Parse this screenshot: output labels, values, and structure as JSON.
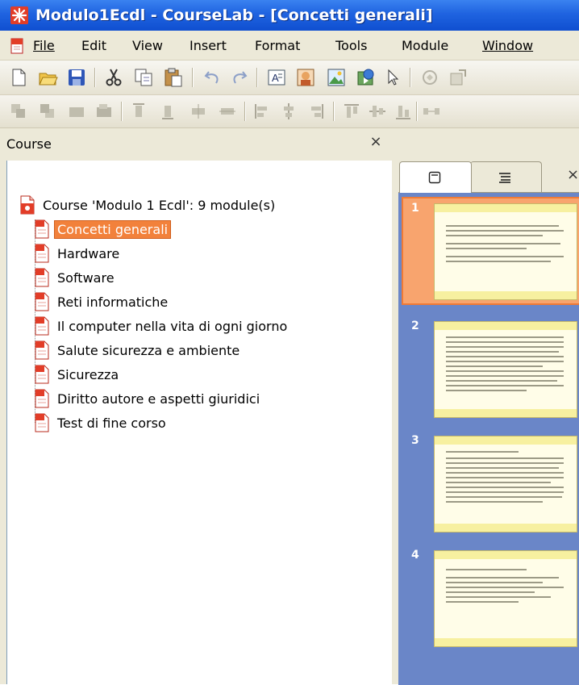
{
  "window": {
    "title": "Modulo1Ecdl - CourseLab - [Concetti generali]"
  },
  "menubar": {
    "items": [
      {
        "label": "File"
      },
      {
        "label": "Edit"
      },
      {
        "label": "View"
      },
      {
        "label": "Insert"
      },
      {
        "label": "Format"
      },
      {
        "label": "Tools"
      },
      {
        "label": "Module"
      },
      {
        "label": "Window"
      }
    ]
  },
  "toolbar1": {
    "icons": [
      "new-icon",
      "open-icon",
      "save-icon",
      "cut-icon",
      "copy-icon",
      "paste-icon",
      "undo-icon",
      "redo-icon",
      "text-box-icon",
      "character-icon",
      "picture-icon",
      "media-icon",
      "pointer-icon",
      "object-icon",
      "properties-icon"
    ]
  },
  "toolbar2": {
    "icons": [
      "bring-front-icon",
      "send-back-icon",
      "forward-icon",
      "backward-icon",
      "align-top-icon",
      "align-bottom-icon",
      "align-center-h-icon",
      "align-center-v-icon",
      "align-left-icon",
      "align-middle-icon",
      "align-right-icon",
      "distribute-top-icon",
      "distribute-middle-icon",
      "distribute-bottom-icon",
      "distribute-horizontal-icon"
    ]
  },
  "course_panel": {
    "title": "Course",
    "close": "×",
    "root": "Course 'Modulo 1 Ecdl': 9 module(s)",
    "modules": [
      {
        "label": "Concetti generali",
        "selected": true
      },
      {
        "label": "Hardware"
      },
      {
        "label": "Software"
      },
      {
        "label": "Reti informatiche"
      },
      {
        "label": "Il computer nella vita di ogni giorno"
      },
      {
        "label": "Salute sicurezza e ambiente"
      },
      {
        "label": "Sicurezza"
      },
      {
        "label": "Diritto autore e aspetti giuridici"
      },
      {
        "label": "Test di fine corso"
      }
    ]
  },
  "slides_panel": {
    "close": "×",
    "tabs": [
      {
        "icon": "slides-icon"
      },
      {
        "icon": "outline-icon"
      }
    ],
    "slides": [
      {
        "number": "1",
        "selected": true
      },
      {
        "number": "2"
      },
      {
        "number": "3"
      },
      {
        "number": "4"
      }
    ]
  },
  "colors": {
    "titlebar": "#1f63e0",
    "selection": "#f2813b",
    "thumbs_bg": "#6a86c8"
  }
}
